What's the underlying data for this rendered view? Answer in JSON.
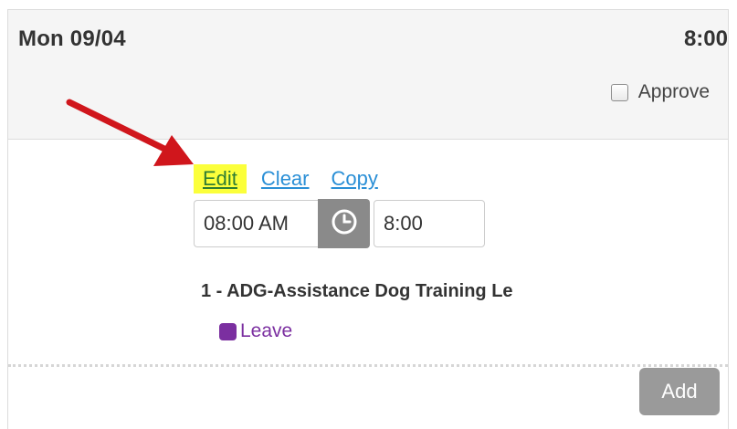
{
  "day": {
    "label": "Mon 09/04",
    "total_hours": "8:00",
    "approve_label": "Approve",
    "approve_checked": false
  },
  "entry": {
    "actions": {
      "edit_label": "Edit",
      "clear_label": "Clear",
      "copy_label": "Copy"
    },
    "start_time": "08:00 AM",
    "hours": "8:00",
    "job": "1 - ADG-Assistance Dog Training Le",
    "category": "Leave",
    "category_color": "#7b2fa0"
  },
  "footer": {
    "add_label": "Add"
  },
  "colors": {
    "highlight": "#fbff3b",
    "link": "#2a8fd6",
    "arrow": "#d0161c"
  },
  "icons": {
    "clock": "clock-icon",
    "arrow": "red-arrow-annotation"
  }
}
